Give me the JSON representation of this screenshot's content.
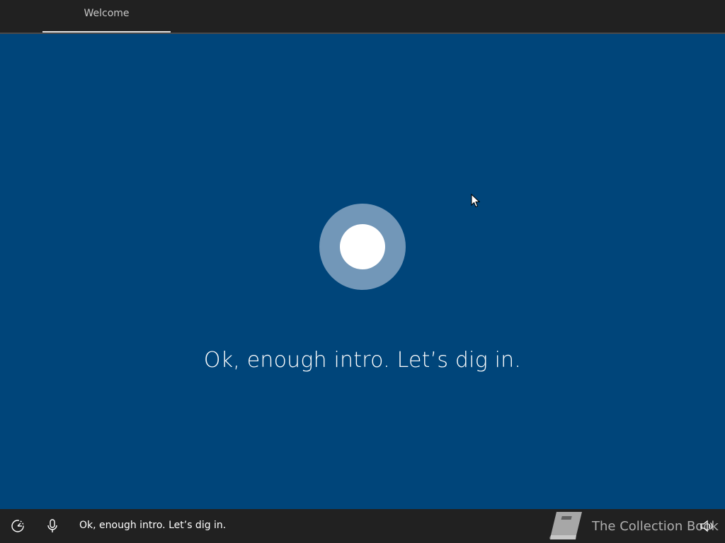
{
  "header": {
    "tabs": [
      {
        "label": "Welcome",
        "active": true
      }
    ]
  },
  "main": {
    "message": "Ok, enough intro. Let’s dig in."
  },
  "footer": {
    "caption": "Ok, enough intro. Let’s dig in.",
    "icons": [
      "accessibility-icon",
      "microphone-icon",
      "volume-icon"
    ],
    "watermark": "The Collection Book"
  },
  "colors": {
    "background": "#00457a",
    "bar": "#212121",
    "orb_outer": "#7297b8",
    "orb_inner": "#ffffff"
  }
}
